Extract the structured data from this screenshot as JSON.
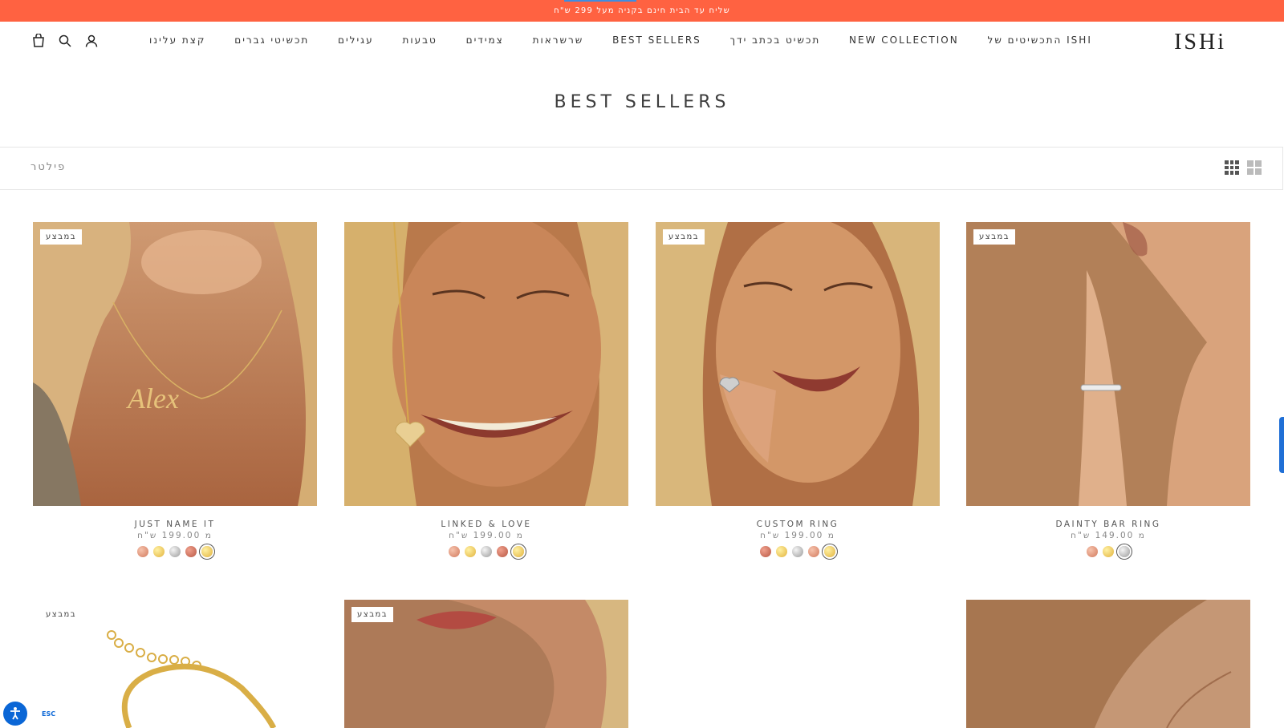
{
  "announcement": {
    "text": "שליח עד הבית חינם בקניה מעל 299 ש\"ח"
  },
  "logo": "ISHi",
  "nav": {
    "items": [
      "התכשיטים של ISHI",
      "NEW COLLECTION",
      "תכשיט בכתב ידך",
      "BEST SELLERS",
      "שרשראות",
      "צמידים",
      "טבעות",
      "עגילים",
      "תכשיטי גברים",
      "קצת עלינו"
    ],
    "icons": [
      "cart-icon",
      "search-icon",
      "account-icon"
    ]
  },
  "page": {
    "title": "BEST SELLERS"
  },
  "filter": {
    "label": "פילטר"
  },
  "products": [
    {
      "name": "JUST NAME IT",
      "price": "מ 199.00 ש\"ח",
      "badge": "במבצע",
      "swatches": [
        "rose",
        "gold",
        "silver",
        "copper",
        "gold"
      ],
      "selected": 4
    },
    {
      "name": "LINKED & LOVE",
      "price": "מ 199.00 ש\"ח",
      "badge": "",
      "swatches": [
        "rose",
        "gold",
        "silver",
        "copper",
        "gold"
      ],
      "selected": 4
    },
    {
      "name": "CUSTOM RING",
      "price": "מ 199.00 ש\"ח",
      "badge": "במבצע",
      "swatches": [
        "copper",
        "gold",
        "silver",
        "rose",
        "gold"
      ],
      "selected": 4
    },
    {
      "name": "DAINTY BAR RING",
      "price": "מ 149.00 ש\"ח",
      "badge": "במבצע",
      "swatches": [
        "rose",
        "gold",
        "silver"
      ],
      "selected": 2
    }
  ],
  "row2": {
    "badge_1": "במבצע",
    "badge_2": "במבצע"
  },
  "accessibility": {
    "esc": "ESC"
  },
  "colors": {
    "accent": "#ff6241",
    "text": "#333333",
    "muted": "#888888",
    "link": "#0a66d6"
  }
}
